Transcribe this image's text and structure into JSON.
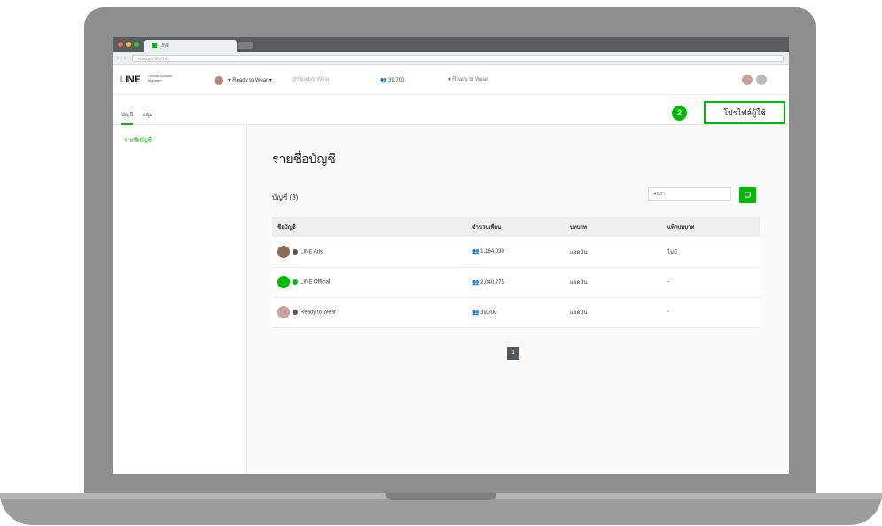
{
  "browser": {
    "tab_title": "LINE",
    "url": "manager.line.biz"
  },
  "header": {
    "logo": "LINE",
    "logo_sub_1": "Official Account",
    "logo_sub_2": "Manager",
    "account_name": "Ready to Wear",
    "account_id": "@ReadytoWear",
    "followers": "39,700",
    "plan": "Ready to Wear"
  },
  "subnav": {
    "tabs": [
      {
        "label": "บัญชี",
        "active": true
      },
      {
        "label": "กลุ่ม",
        "active": false
      }
    ],
    "step_number": "2",
    "profile_button": "โปรไฟล์ผู้ใช้"
  },
  "sidebar": {
    "items": [
      {
        "label": "รายชื่อบัญชี",
        "active": true
      }
    ]
  },
  "main": {
    "title": "รายชื่อบัญชี",
    "count_label": "บัญชี (3)",
    "search_placeholder": "ค้นหา",
    "table": {
      "columns": [
        "ชื่อบัญชี",
        "จำนวนเพื่อน",
        "บทบาท",
        "แท็กบทบาท"
      ],
      "rows": [
        {
          "name": "LINE Ads",
          "friends": "1,164,030",
          "role": "แอดมิน",
          "tag": "ไม่มี",
          "avatar_color": "#8a6a58"
        },
        {
          "name": "LINE Official",
          "friends": "2,040,775",
          "role": "แอดมิน",
          "tag": "-",
          "avatar_color": "#00b900"
        },
        {
          "name": "Ready to Wear",
          "friends": "39,700",
          "role": "แอดมิน",
          "tag": "-",
          "avatar_color": "#c9a29a"
        }
      ]
    },
    "pagination": {
      "current": "1"
    }
  },
  "colors": {
    "accent": "#00b900",
    "laptop": "#8d8f8e"
  }
}
